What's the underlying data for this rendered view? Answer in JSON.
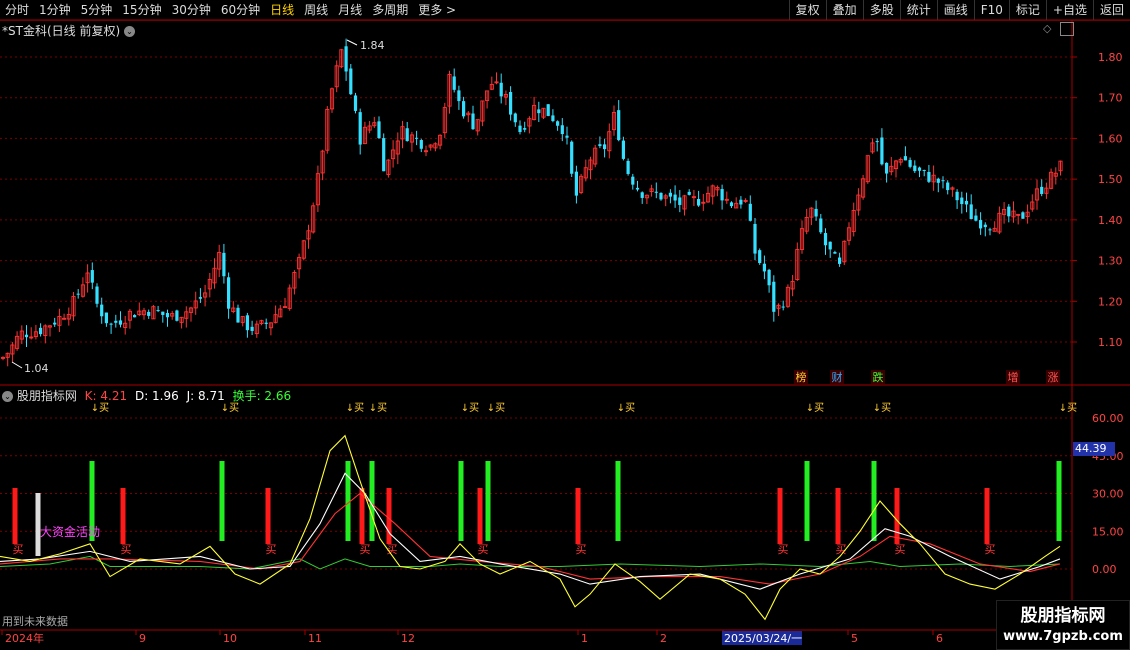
{
  "toolbar": {
    "timeframes": [
      "分时",
      "1分钟",
      "5分钟",
      "15分钟",
      "30分钟",
      "60分钟",
      "日线",
      "周线",
      "月线",
      "多周期",
      "更多 >"
    ],
    "active_timeframe": "日线",
    "right_buttons": [
      "复权",
      "叠加",
      "多股",
      "统计",
      "画线",
      "F10",
      "标记",
      "+自选",
      "返回"
    ]
  },
  "main_chart": {
    "title": "*ST金科(日线 前复权)",
    "high_marker": "1.84",
    "low_marker": "1.04",
    "y_ticks": [
      "1.80",
      "1.70",
      "1.60",
      "1.50",
      "1.40",
      "1.30",
      "1.20",
      "1.10"
    ],
    "tags": [
      {
        "text": "榜",
        "color": "#ffcc33"
      },
      {
        "text": "财",
        "color": "#33aaff"
      },
      {
        "text": "跌",
        "color": "#33ff33"
      },
      {
        "text": "增",
        "color": "#ff5555"
      },
      {
        "text": "涨",
        "color": "#ff5555"
      }
    ]
  },
  "indicator": {
    "name": "股朋指标网",
    "k_label": "K: 4.21",
    "d_label": "D: 1.96",
    "j_label": "J: 8.71",
    "turnover_label": "换手: 2.66",
    "current_value": "44.39",
    "y_ticks": [
      "60.00",
      "45.00",
      "30.00",
      "15.00",
      "0.00"
    ],
    "annotation": "大资金活动",
    "buy_text": "买",
    "marker_text": "↓买"
  },
  "x_axis": {
    "labels": [
      "2024年",
      "9",
      "10",
      "11",
      "12",
      "1",
      "2",
      "3",
      "2025/03/24/一",
      "5",
      "6"
    ],
    "highlighted": "2025/03/24/一"
  },
  "footer_note": "用到未来数据",
  "watermark": {
    "line1": "股朋指标网",
    "line2": "www.7gpzb.com"
  },
  "colors": {
    "up": "#ff3333",
    "down": "#33e0ff",
    "grid": "#7a0000",
    "k": "#ffffff",
    "d": "#ffff33",
    "j": "#ff3333",
    "turnover": "#33cc33"
  },
  "chart_data": {
    "type": "candlestick",
    "title": "*ST金科(日线 前复权)",
    "price_range": [
      1.04,
      1.84
    ],
    "y_ticks": [
      1.1,
      1.2,
      1.3,
      1.4,
      1.5,
      1.6,
      1.7,
      1.8
    ],
    "price_path": [
      [
        2,
        1.06
      ],
      [
        10,
        1.08
      ],
      [
        20,
        1.12
      ],
      [
        40,
        1.13
      ],
      [
        60,
        1.16
      ],
      [
        75,
        1.2
      ],
      [
        88,
        1.28
      ],
      [
        95,
        1.2
      ],
      [
        110,
        1.14
      ],
      [
        130,
        1.17
      ],
      [
        150,
        1.18
      ],
      [
        170,
        1.16
      ],
      [
        190,
        1.18
      ],
      [
        205,
        1.22
      ],
      [
        220,
        1.32
      ],
      [
        228,
        1.2
      ],
      [
        240,
        1.15
      ],
      [
        255,
        1.13
      ],
      [
        270,
        1.15
      ],
      [
        285,
        1.2
      ],
      [
        300,
        1.3
      ],
      [
        308,
        1.38
      ],
      [
        318,
        1.5
      ],
      [
        330,
        1.7
      ],
      [
        342,
        1.82
      ],
      [
        350,
        1.72
      ],
      [
        360,
        1.6
      ],
      [
        375,
        1.65
      ],
      [
        385,
        1.52
      ],
      [
        400,
        1.62
      ],
      [
        415,
        1.6
      ],
      [
        430,
        1.58
      ],
      [
        440,
        1.62
      ],
      [
        450,
        1.75
      ],
      [
        460,
        1.68
      ],
      [
        475,
        1.63
      ],
      [
        490,
        1.74
      ],
      [
        505,
        1.7
      ],
      [
        520,
        1.62
      ],
      [
        535,
        1.68
      ],
      [
        550,
        1.66
      ],
      [
        565,
        1.62
      ],
      [
        575,
        1.45
      ],
      [
        590,
        1.55
      ],
      [
        605,
        1.58
      ],
      [
        615,
        1.66
      ],
      [
        625,
        1.53
      ],
      [
        640,
        1.47
      ],
      [
        660,
        1.46
      ],
      [
        680,
        1.44
      ],
      [
        700,
        1.45
      ],
      [
        715,
        1.48
      ],
      [
        730,
        1.44
      ],
      [
        745,
        1.45
      ],
      [
        755,
        1.32
      ],
      [
        765,
        1.27
      ],
      [
        775,
        1.17
      ],
      [
        790,
        1.23
      ],
      [
        800,
        1.35
      ],
      [
        810,
        1.43
      ],
      [
        825,
        1.34
      ],
      [
        840,
        1.28
      ],
      [
        850,
        1.4
      ],
      [
        862,
        1.5
      ],
      [
        875,
        1.62
      ],
      [
        885,
        1.5
      ],
      [
        900,
        1.56
      ],
      [
        915,
        1.52
      ],
      [
        935,
        1.5
      ],
      [
        955,
        1.46
      ],
      [
        975,
        1.4
      ],
      [
        990,
        1.39
      ],
      [
        1005,
        1.41
      ],
      [
        1020,
        1.4
      ],
      [
        1035,
        1.46
      ],
      [
        1050,
        1.5
      ],
      [
        1060,
        1.53
      ]
    ],
    "indicator": {
      "k_end": 4.21,
      "d_end": 1.96,
      "j_end": 8.71,
      "turnover_end": 2.66,
      "y_range": [
        -8,
        66
      ],
      "y_ticks": [
        0,
        15,
        30,
        45,
        60
      ],
      "j_path": [
        [
          0,
          5
        ],
        [
          30,
          3
        ],
        [
          60,
          6
        ],
        [
          90,
          10
        ],
        [
          110,
          -3
        ],
        [
          140,
          4
        ],
        [
          180,
          2
        ],
        [
          210,
          9
        ],
        [
          235,
          -2
        ],
        [
          260,
          -6
        ],
        [
          290,
          2
        ],
        [
          310,
          20
        ],
        [
          330,
          47
        ],
        [
          345,
          53
        ],
        [
          360,
          35
        ],
        [
          380,
          12
        ],
        [
          400,
          1
        ],
        [
          420,
          0
        ],
        [
          445,
          3
        ],
        [
          460,
          10
        ],
        [
          480,
          2
        ],
        [
          500,
          -2
        ],
        [
          530,
          3
        ],
        [
          560,
          -4
        ],
        [
          575,
          -15
        ],
        [
          590,
          -10
        ],
        [
          615,
          2
        ],
        [
          640,
          -5
        ],
        [
          660,
          -12
        ],
        [
          690,
          -2
        ],
        [
          720,
          -4
        ],
        [
          745,
          -10
        ],
        [
          765,
          -20
        ],
        [
          780,
          -8
        ],
        [
          800,
          0
        ],
        [
          820,
          -2
        ],
        [
          840,
          5
        ],
        [
          860,
          15
        ],
        [
          880,
          27
        ],
        [
          900,
          18
        ],
        [
          920,
          10
        ],
        [
          945,
          -2
        ],
        [
          970,
          -6
        ],
        [
          995,
          -8
        ],
        [
          1020,
          -2
        ],
        [
          1045,
          5
        ],
        [
          1060,
          9
        ]
      ],
      "k_path": [
        [
          0,
          3
        ],
        [
          40,
          4
        ],
        [
          90,
          7
        ],
        [
          130,
          3
        ],
        [
          200,
          5
        ],
        [
          250,
          0
        ],
        [
          290,
          1
        ],
        [
          320,
          18
        ],
        [
          345,
          38
        ],
        [
          365,
          30
        ],
        [
          390,
          14
        ],
        [
          420,
          3
        ],
        [
          460,
          5
        ],
        [
          500,
          2
        ],
        [
          560,
          -2
        ],
        [
          590,
          -6
        ],
        [
          640,
          -3
        ],
        [
          700,
          -2
        ],
        [
          760,
          -8
        ],
        [
          800,
          -2
        ],
        [
          850,
          4
        ],
        [
          885,
          16
        ],
        [
          910,
          13
        ],
        [
          950,
          5
        ],
        [
          1000,
          -4
        ],
        [
          1040,
          1
        ],
        [
          1060,
          4
        ]
      ],
      "d_path": [
        [
          0,
          2
        ],
        [
          60,
          4
        ],
        [
          110,
          4
        ],
        [
          200,
          3
        ],
        [
          260,
          0
        ],
        [
          300,
          3
        ],
        [
          335,
          22
        ],
        [
          360,
          30
        ],
        [
          395,
          18
        ],
        [
          430,
          5
        ],
        [
          480,
          3
        ],
        [
          540,
          1
        ],
        [
          590,
          -4
        ],
        [
          650,
          -3
        ],
        [
          720,
          -3
        ],
        [
          770,
          -6
        ],
        [
          820,
          -2
        ],
        [
          860,
          5
        ],
        [
          890,
          13
        ],
        [
          930,
          10
        ],
        [
          980,
          2
        ],
        [
          1030,
          -1
        ],
        [
          1060,
          2
        ]
      ],
      "turnover_path": [
        [
          0,
          1
        ],
        [
          50,
          2
        ],
        [
          90,
          5
        ],
        [
          110,
          1
        ],
        [
          200,
          1
        ],
        [
          250,
          0
        ],
        [
          300,
          4
        ],
        [
          320,
          0
        ],
        [
          345,
          4
        ],
        [
          370,
          1
        ],
        [
          430,
          1
        ],
        [
          460,
          2
        ],
        [
          500,
          1
        ],
        [
          560,
          1
        ],
        [
          620,
          2
        ],
        [
          700,
          1
        ],
        [
          760,
          2
        ],
        [
          820,
          1
        ],
        [
          870,
          3
        ],
        [
          900,
          1
        ],
        [
          960,
          2
        ],
        [
          1010,
          1
        ],
        [
          1060,
          2
        ]
      ],
      "red_bars_x": [
        15,
        123,
        268,
        362,
        389,
        480,
        578,
        780,
        838,
        897,
        987
      ],
      "green_bars_x": [
        92,
        222,
        348,
        372,
        461,
        488,
        618,
        807,
        874,
        1059
      ],
      "white_bar_x": [
        38
      ],
      "buy_markers_x": [
        100,
        230,
        355,
        378,
        470,
        496,
        626,
        815,
        882,
        1068
      ]
    }
  }
}
